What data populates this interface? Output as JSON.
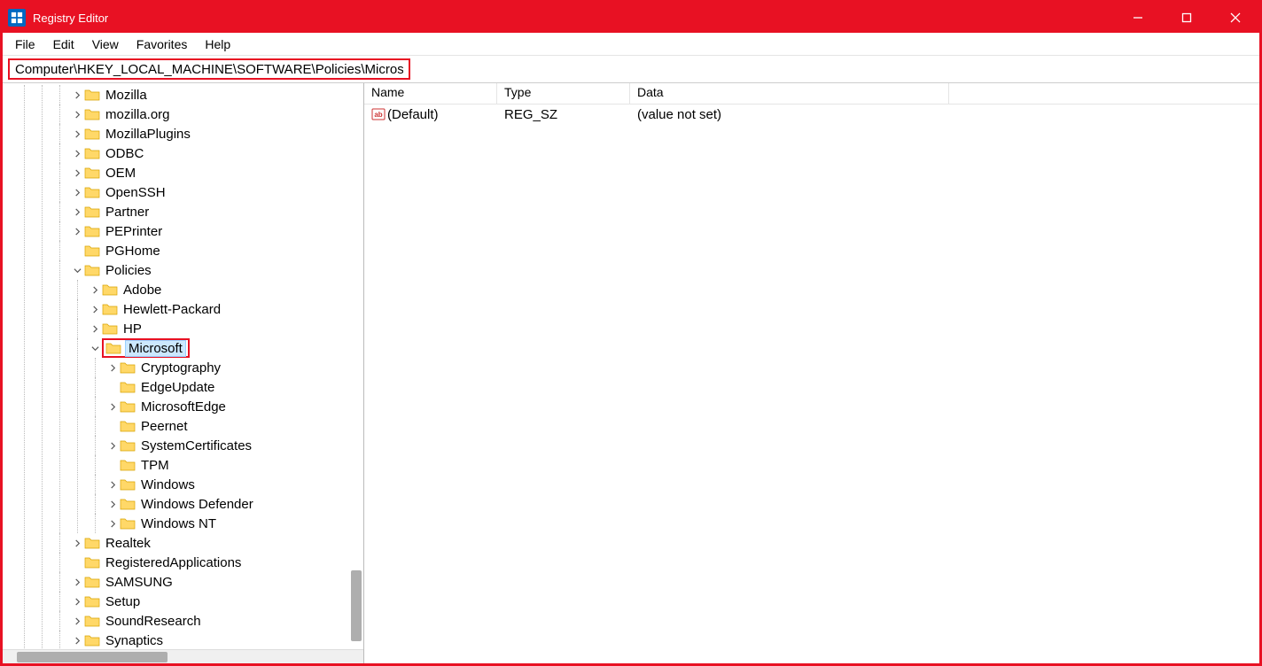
{
  "window": {
    "title": "Registry Editor"
  },
  "menu": {
    "file": "File",
    "edit": "Edit",
    "view": "View",
    "favorites": "Favorites",
    "help": "Help"
  },
  "address": {
    "path": "Computer\\HKEY_LOCAL_MACHINE\\SOFTWARE\\Policies\\Microsoft"
  },
  "tree": {
    "visible_nodes": {
      "mozilla": "Mozilla",
      "mozilla_org": "mozilla.org",
      "mozillaplugins": "MozillaPlugins",
      "odbc": "ODBC",
      "oem": "OEM",
      "openssh": "OpenSSH",
      "partner": "Partner",
      "peprinter": "PEPrinter",
      "pghome": "PGHome",
      "policies": "Policies",
      "policies_children": {
        "adobe": "Adobe",
        "hewlett": "Hewlett-Packard",
        "hp": "HP",
        "microsoft": "Microsoft",
        "microsoft_children": {
          "cryptography": "Cryptography",
          "edgeupdate": "EdgeUpdate",
          "microsoftedge": "MicrosoftEdge",
          "peernet": "Peernet",
          "systemcertificates": "SystemCertificates",
          "tpm": "TPM",
          "windows": "Windows",
          "windowsdefender": "Windows Defender",
          "windowsnt": "Windows NT"
        }
      },
      "realtek": "Realtek",
      "registeredapplications": "RegisteredApplications",
      "samsung": "SAMSUNG",
      "setup": "Setup",
      "soundresearch": "SoundResearch",
      "synaptics": "Synaptics"
    }
  },
  "list": {
    "columns": {
      "name": "Name",
      "type": "Type",
      "data": "Data"
    },
    "rows": [
      {
        "name": "(Default)",
        "type": "REG_SZ",
        "data": "(value not set)"
      }
    ]
  }
}
